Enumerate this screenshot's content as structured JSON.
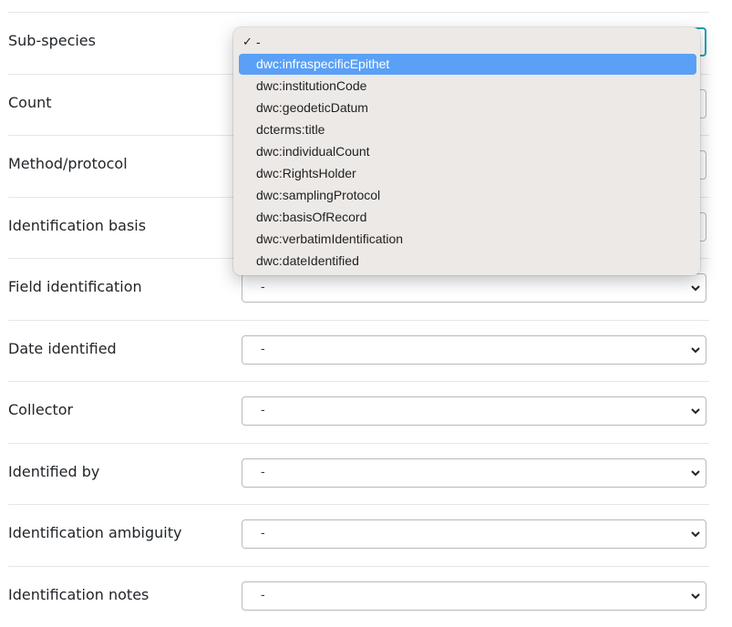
{
  "form": {
    "rows": [
      {
        "label": "Sub-species",
        "value": "-"
      },
      {
        "label": "Count",
        "value": "-"
      },
      {
        "label": "Method/protocol",
        "value": "-"
      },
      {
        "label": "Identification basis",
        "value": "-"
      },
      {
        "label": "Field identification",
        "value": "-"
      },
      {
        "label": "Date identified",
        "value": "-"
      },
      {
        "label": "Collector",
        "value": "-"
      },
      {
        "label": "Identified by",
        "value": "-"
      },
      {
        "label": "Identification ambiguity",
        "value": "-"
      },
      {
        "label": "Identification notes",
        "value": "-"
      }
    ]
  },
  "dropdown": {
    "open_for": "Sub-species",
    "selected": "-",
    "highlighted": "dwc:infraspecificEpithet",
    "check_icon": "✓",
    "options": [
      "-",
      "dwc:infraspecificEpithet",
      "dwc:institutionCode",
      "dwc:geodeticDatum",
      "dcterms:title",
      "dwc:individualCount",
      "dwc:RightsHolder",
      "dwc:samplingProtocol",
      "dwc:basisOfRecord",
      "dwc:verbatimIdentification",
      "dwc:dateIdentified"
    ]
  },
  "colors": {
    "focus_border": "#1aa3b3",
    "highlight": "#5aa0f7",
    "popup_bg": "#ece9e7"
  }
}
